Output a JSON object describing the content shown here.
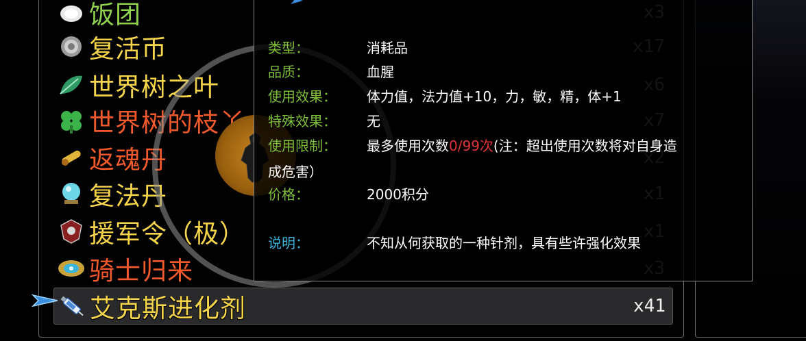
{
  "inventory": {
    "items": [
      {
        "name": "饭团",
        "qty": "x3",
        "color": "#8fd14f",
        "icon": "rice-ball-icon"
      },
      {
        "name": "复活币",
        "qty": "x17",
        "color": "#f6d54a",
        "icon": "revive-coin-icon"
      },
      {
        "name": "世界树之叶",
        "qty": "x6",
        "color": "#f6d54a",
        "icon": "world-tree-leaf-icon"
      },
      {
        "name": "世界树的枝丫",
        "qty": "x7",
        "color": "#f25a2c",
        "icon": "world-tree-branch-icon"
      },
      {
        "name": "返魂丹",
        "qty": "x2",
        "color": "#f25a2c",
        "icon": "soul-return-pill-icon"
      },
      {
        "name": "复法丹",
        "qty": "x1",
        "color": "#f6d54a",
        "icon": "mana-pill-icon"
      },
      {
        "name": "援军令（极）",
        "qty": "x1",
        "color": "#f6d54a",
        "icon": "reinforcement-token-icon"
      },
      {
        "name": "骑士归来",
        "qty": "x3",
        "color": "#f25a2c",
        "icon": "knight-return-icon"
      },
      {
        "name": "艾克斯进化剂",
        "qty": "x41",
        "color": "#f6d54a",
        "icon": "syringe-icon"
      }
    ],
    "selected_index": 8
  },
  "detail": {
    "type_label": "类型：",
    "type_value": "消耗品",
    "quality_label": "品质：",
    "quality_value": "血腥",
    "use_effect_label": "使用效果：",
    "use_effect_value": "体力值，法力值+10，力，敏，精，体+1",
    "special_effect_label": "特殊效果：",
    "special_effect_value": "无",
    "use_limit_label": "使用限制：",
    "use_limit_prefix": "最多使用次数",
    "use_limit_count": "0/99次",
    "use_limit_suffix": "(注：超出使用次数将对自身造",
    "use_limit_line2": "成危害）",
    "price_label": "价格：",
    "price_value": "2000积分",
    "desc_label": "说明：",
    "desc_value": "不知从何获取的一种针剂，具有些许强化效果"
  },
  "colors": {
    "label_green": "#7fbf3a",
    "label_blue": "#3fb3d8",
    "warning_red": "#e0323a",
    "name_yellow": "#f6d54a",
    "name_orange": "#f25a2c",
    "name_green": "#8fd14f"
  }
}
